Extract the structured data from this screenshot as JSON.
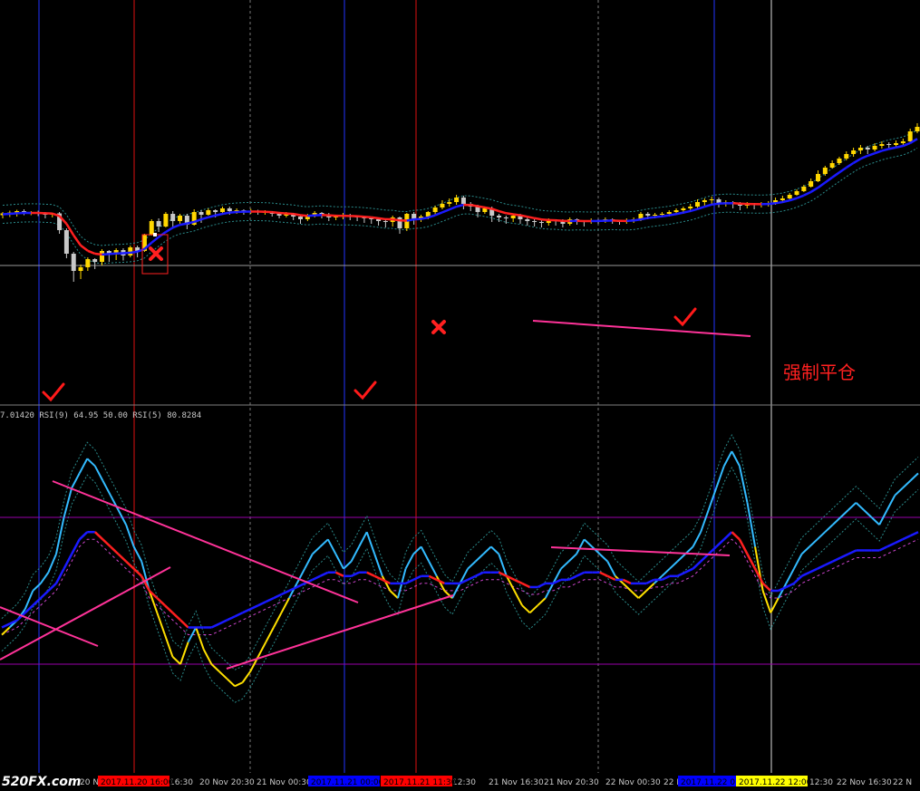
{
  "indicator_label": "7.01420  RSI(9) 64.95 50.00  RSI(5) 80.8284",
  "annotation_text": "强制平仓",
  "watermark": "520FX.com",
  "x_axis": {
    "labels": [
      "20 N",
      "16:30",
      "20 Nov 20:30",
      "21 Nov 00:30",
      "12:30",
      "21 Nov 16:30",
      "21 Nov 20:30",
      "22 Nov 00:30",
      "22 N",
      "12:30",
      "22 Nov 16:30",
      "22 N"
    ],
    "markers": [
      {
        "text": "2017.11.20 16:00",
        "color": "#ff0000",
        "text_color": "#000000"
      },
      {
        "text": "2017.11.21 00:00",
        "color": "#0000ff",
        "text_color": "#000000"
      },
      {
        "text": "2017.11.21 11:30",
        "color": "#ff0000",
        "text_color": "#000000"
      },
      {
        "text": "2017.11.22 0",
        "color": "#0000ff",
        "text_color": "#000000"
      },
      {
        "text": "2017.11.22 12:00",
        "color": "#ffff00",
        "text_color": "#000000"
      }
    ]
  },
  "colors": {
    "background": "#000000",
    "bull_candle": "#ffd700",
    "bear_candle": "#c8c8c8",
    "trend_up": "#1a1aff",
    "trend_down": "#ff2020",
    "rsi_fast": "#33bbff",
    "rsi_yellow": "#ffe000",
    "trendline": "#ff3399",
    "level": "#9900aa",
    "grid": "#808080",
    "check": "#ff0000",
    "cross": "#ff0000"
  },
  "chart_data": [
    {
      "type": "candlestick",
      "title": "",
      "candles": [
        [
          385,
          389,
          380,
          392,
          378
        ],
        [
          389,
          391,
          383,
          395,
          381
        ],
        [
          391,
          394,
          384,
          397,
          382
        ],
        [
          394,
          389,
          386,
          398,
          385
        ],
        [
          389,
          392,
          387,
          394,
          385
        ],
        [
          392,
          388,
          385,
          395,
          383
        ],
        [
          388,
          386,
          380,
          392,
          378
        ],
        [
          386,
          389,
          382,
          390,
          380
        ],
        [
          389,
          352,
          346,
          392,
          344
        ],
        [
          352,
          300,
          292,
          356,
          290
        ],
        [
          300,
          262,
          250,
          304,
          238
        ],
        [
          262,
          270,
          255,
          276,
          244
        ],
        [
          270,
          288,
          266,
          292,
          262
        ],
        [
          288,
          282,
          270,
          290,
          266
        ],
        [
          282,
          306,
          278,
          310,
          274
        ],
        [
          306,
          298,
          286,
          308,
          282
        ],
        [
          298,
          308,
          290,
          312,
          286
        ],
        [
          308,
          296,
          288,
          312,
          285
        ],
        [
          296,
          314,
          300,
          318,
          292
        ],
        [
          314,
          306,
          294,
          318,
          292
        ],
        [
          306,
          342,
          320,
          344,
          304
        ],
        [
          342,
          372,
          352,
          376,
          340
        ],
        [
          372,
          360,
          350,
          378,
          348
        ],
        [
          360,
          388,
          378,
          392,
          358
        ],
        [
          388,
          372,
          360,
          394,
          356
        ],
        [
          372,
          384,
          370,
          388,
          366
        ],
        [
          384,
          364,
          358,
          388,
          354
        ],
        [
          364,
          392,
          380,
          398,
          362
        ],
        [
          392,
          386,
          372,
          396,
          368
        ],
        [
          386,
          396,
          388,
          400,
          384
        ],
        [
          396,
          392,
          384,
          398,
          380
        ],
        [
          392,
          400,
          390,
          404,
          386
        ],
        [
          400,
          394,
          388,
          404,
          386
        ],
        [
          394,
          396,
          390,
          400,
          388
        ],
        [
          396,
          393,
          388,
          398,
          386
        ],
        [
          393,
          395,
          390,
          399,
          388
        ],
        [
          395,
          391,
          387,
          397,
          386
        ],
        [
          391,
          392,
          388,
          396,
          386
        ],
        [
          392,
          388,
          384,
          394,
          382
        ],
        [
          388,
          384,
          380,
          392,
          378
        ],
        [
          384,
          388,
          382,
          392,
          380
        ],
        [
          388,
          382,
          376,
          390,
          374
        ],
        [
          382,
          376,
          370,
          386,
          366
        ],
        [
          376,
          384,
          378,
          388,
          372
        ],
        [
          384,
          390,
          384,
          394,
          380
        ],
        [
          390,
          386,
          380,
          392,
          378
        ],
        [
          386,
          380,
          376,
          390,
          372
        ],
        [
          380,
          382,
          378,
          386,
          374
        ],
        [
          382,
          384,
          378,
          390,
          376
        ],
        [
          384,
          382,
          376,
          388,
          374
        ],
        [
          382,
          380,
          374,
          384,
          372
        ],
        [
          380,
          378,
          372,
          382,
          368
        ],
        [
          378,
          376,
          370,
          380,
          366
        ],
        [
          376,
          372,
          366,
          380,
          362
        ],
        [
          372,
          370,
          364,
          376,
          358
        ],
        [
          370,
          380,
          372,
          384,
          360
        ],
        [
          380,
          356,
          360,
          382,
          344
        ],
        [
          356,
          388,
          378,
          390,
          350
        ],
        [
          388,
          376,
          370,
          392,
          364
        ],
        [
          376,
          382,
          374,
          386,
          370
        ],
        [
          382,
          392,
          386,
          394,
          376
        ],
        [
          392,
          402,
          390,
          406,
          386
        ],
        [
          402,
          410,
          404,
          418,
          398
        ],
        [
          410,
          414,
          408,
          422,
          404
        ],
        [
          414,
          424,
          418,
          430,
          408
        ],
        [
          424,
          410,
          400,
          428,
          398
        ],
        [
          410,
          404,
          398,
          414,
          394
        ],
        [
          404,
          392,
          386,
          408,
          380
        ],
        [
          392,
          400,
          394,
          404,
          388
        ],
        [
          400,
          384,
          378,
          404,
          370
        ],
        [
          384,
          380,
          374,
          388,
          370
        ],
        [
          380,
          378,
          370,
          384,
          366
        ],
        [
          378,
          384,
          374,
          388,
          370
        ],
        [
          384,
          376,
          370,
          388,
          366
        ],
        [
          376,
          372,
          366,
          380,
          362
        ],
        [
          372,
          370,
          364,
          376,
          360
        ],
        [
          370,
          368,
          362,
          374,
          358
        ],
        [
          368,
          374,
          366,
          378,
          362
        ],
        [
          374,
          372,
          366,
          376,
          362
        ],
        [
          372,
          366,
          362,
          376,
          358
        ],
        [
          366,
          376,
          368,
          380,
          362
        ],
        [
          376,
          372,
          366,
          378,
          364
        ],
        [
          372,
          370,
          364,
          374,
          360
        ],
        [
          370,
          374,
          368,
          378,
          366
        ],
        [
          374,
          372,
          368,
          376,
          366
        ],
        [
          372,
          376,
          370,
          380,
          368
        ],
        [
          376,
          372,
          368,
          378,
          366
        ],
        [
          372,
          370,
          366,
          374,
          364
        ],
        [
          370,
          374,
          368,
          378,
          366
        ],
        [
          374,
          376,
          370,
          380,
          368
        ],
        [
          376,
          388,
          382,
          392,
          372
        ],
        [
          388,
          384,
          380,
          392,
          376
        ],
        [
          384,
          386,
          380,
          390,
          378
        ],
        [
          386,
          388,
          382,
          392,
          380
        ],
        [
          388,
          392,
          384,
          396,
          382
        ],
        [
          392,
          396,
          388,
          400,
          386
        ],
        [
          396,
          400,
          390,
          404,
          388
        ],
        [
          400,
          404,
          396,
          410,
          392
        ],
        [
          404,
          414,
          406,
          420,
          398
        ],
        [
          414,
          418,
          410,
          422,
          406
        ],
        [
          418,
          420,
          412,
          426,
          408
        ],
        [
          420,
          412,
          406,
          424,
          402
        ],
        [
          412,
          414,
          406,
          418,
          404
        ],
        [
          414,
          410,
          404,
          416,
          400
        ],
        [
          410,
          406,
          400,
          414,
          396
        ],
        [
          406,
          410,
          402,
          414,
          400
        ],
        [
          410,
          408,
          402,
          412,
          398
        ],
        [
          408,
          410,
          404,
          414,
          402
        ],
        [
          410,
          412,
          406,
          416,
          404
        ],
        [
          412,
          418,
          412,
          424,
          408
        ],
        [
          418,
          422,
          414,
          428,
          412
        ],
        [
          422,
          430,
          424,
          434,
          418
        ],
        [
          430,
          438,
          434,
          442,
          428
        ],
        [
          438,
          448,
          444,
          452,
          436
        ],
        [
          448,
          460,
          456,
          466,
          446
        ],
        [
          460,
          476,
          470,
          484,
          458
        ],
        [
          476,
          490,
          484,
          494,
          472
        ],
        [
          490,
          500,
          494,
          506,
          488
        ],
        [
          500,
          510,
          504,
          514,
          496
        ],
        [
          510,
          520,
          514,
          526,
          506
        ],
        [
          520,
          528,
          522,
          534,
          514
        ],
        [
          528,
          534,
          526,
          540,
          520
        ],
        [
          534,
          530,
          524,
          538,
          520
        ],
        [
          530,
          538,
          532,
          544,
          526
        ],
        [
          538,
          542,
          536,
          548,
          532
        ],
        [
          542,
          540,
          534,
          546,
          532
        ],
        [
          540,
          544,
          538,
          550,
          536
        ],
        [
          544,
          548,
          542,
          554,
          540
        ],
        [
          548,
          570,
          564,
          576,
          546
        ],
        [
          570,
          580,
          574,
          588,
          566
        ]
      ],
      "note": "Each candle is [open_display, high_display, low_display, high_wick, low_wick] in arbitrary price-index units read from the chart (no price axis printed)."
    },
    {
      "type": "line",
      "title": "RSI(9) / RSI(5)",
      "levels": [
        50,
        30,
        70
      ],
      "series": [
        {
          "name": "RSI(5)",
          "values": [
            38,
            40,
            42,
            45,
            50,
            52,
            55,
            60,
            70,
            78,
            82,
            86,
            84,
            80,
            76,
            72,
            68,
            62,
            58,
            50,
            44,
            38,
            32,
            30,
            36,
            40,
            34,
            30,
            28,
            26,
            24,
            25,
            28,
            32,
            36,
            40,
            44,
            48,
            52,
            56,
            60,
            62,
            64,
            60,
            56,
            58,
            62,
            66,
            60,
            54,
            50,
            48,
            56,
            60,
            62,
            58,
            54,
            50,
            48,
            52,
            56,
            58,
            60,
            62,
            60,
            54,
            50,
            46,
            44,
            46,
            48,
            52,
            56,
            58,
            60,
            64,
            62,
            60,
            58,
            54,
            52,
            50,
            48,
            50,
            52,
            54,
            56,
            58,
            60,
            62,
            66,
            72,
            78,
            84,
            88,
            84,
            74,
            62,
            50,
            44,
            48,
            52,
            56,
            60,
            62,
            64,
            66,
            68,
            70,
            72,
            74,
            72,
            70,
            68,
            72,
            76,
            78,
            80,
            82
          ]
        },
        {
          "name": "RSI(9)",
          "values": [
            40,
            41,
            42,
            44,
            46,
            48,
            50,
            52,
            56,
            60,
            64,
            66,
            66,
            64,
            62,
            60,
            58,
            56,
            54,
            50,
            48,
            46,
            44,
            42,
            40,
            40,
            40,
            40,
            41,
            42,
            43,
            44,
            45,
            46,
            47,
            48,
            49,
            50,
            51,
            52,
            53,
            54,
            55,
            55,
            54,
            54,
            55,
            55,
            54,
            53,
            52,
            52,
            52,
            53,
            54,
            54,
            53,
            52,
            52,
            52,
            53,
            54,
            55,
            55,
            55,
            54,
            53,
            52,
            51,
            51,
            52,
            52,
            53,
            53,
            54,
            55,
            55,
            55,
            54,
            53,
            53,
            52,
            52,
            52,
            53,
            53,
            54,
            54,
            55,
            56,
            58,
            60,
            62,
            64,
            66,
            64,
            60,
            56,
            52,
            50,
            50,
            51,
            52,
            54,
            55,
            56,
            57,
            58,
            59,
            60,
            61,
            61,
            61,
            61,
            62,
            63,
            64,
            65,
            66
          ]
        }
      ]
    }
  ]
}
